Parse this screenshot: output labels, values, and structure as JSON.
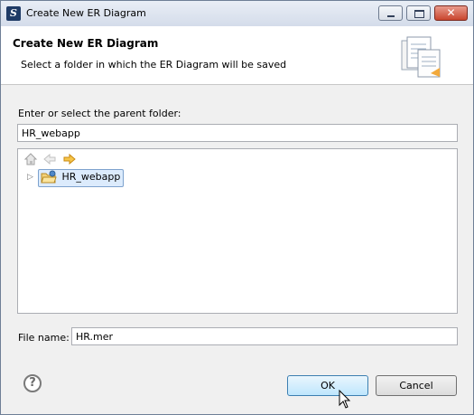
{
  "window": {
    "title": "Create New ER Diagram",
    "app_icon": "eclipse-s-icon",
    "controls": {
      "minimize": "minimize-icon",
      "maximize": "maximize-icon",
      "close": "close-icon"
    }
  },
  "header": {
    "title": "Create New ER Diagram",
    "description": "Select a folder in which the ER Diagram will be saved",
    "icon": "document-wizard-icon"
  },
  "folder": {
    "label": "Enter or select the parent folder:",
    "value": "HR_webapp"
  },
  "tree": {
    "toolbar": [
      "home-icon",
      "back-arrow-icon",
      "forward-arrow-icon"
    ],
    "items": [
      {
        "label": "HR_webapp",
        "icon": "project-folder-icon",
        "selected": true,
        "expandable": true
      }
    ]
  },
  "file": {
    "label": "File name:",
    "value": "HR.mer"
  },
  "buttons": {
    "help": "?",
    "ok": "OK",
    "cancel": "Cancel"
  },
  "colors": {
    "selection_bg": "#dcebfc",
    "selection_border": "#7da2ce",
    "ok_border": "#3c7fb1"
  }
}
